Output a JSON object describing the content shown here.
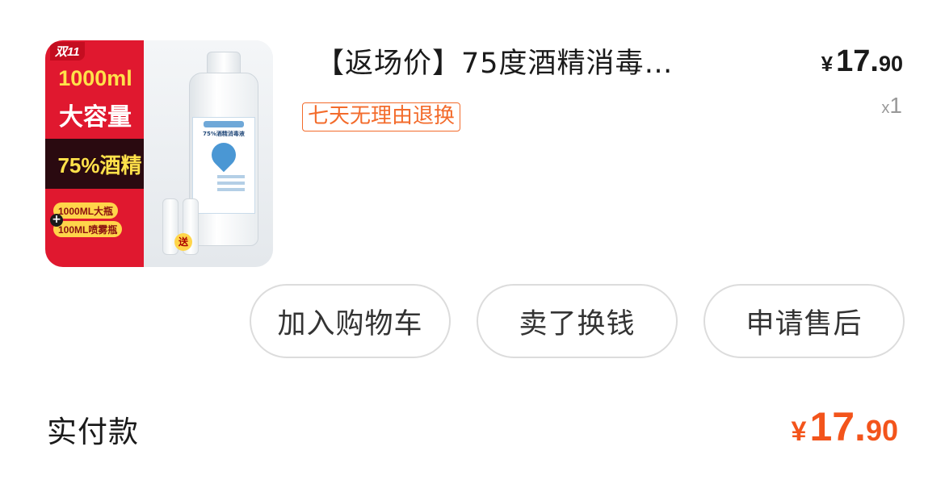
{
  "product": {
    "image": {
      "promo_tag": "双11",
      "volume": "1000ml",
      "capacity": "大容量",
      "alcohol": "75%酒精",
      "pill_1": "1000ML大瓶",
      "pill_2": "100ML喷雾瓶",
      "plus": "+",
      "gift": "送",
      "bottle_label": "75%酒精消毒液"
    },
    "title": "【返场价】75度酒精消毒…",
    "price": {
      "currency": "¥",
      "integer": "17.",
      "decimal": "90"
    },
    "quantity": {
      "prefix": "x",
      "count": "1"
    },
    "service_badge": "七天无理由退换"
  },
  "actions": {
    "add_to_cart": "加入购物车",
    "resell": "卖了换钱",
    "after_sales": "申请售后"
  },
  "summary": {
    "label": "实付款",
    "total": {
      "currency": "¥",
      "integer": "17.",
      "decimal": "90"
    }
  },
  "colors": {
    "accent": "#f3541b",
    "badge": "#f36b2b",
    "promo_red": "#e0182f",
    "promo_yellow": "#ffe14a",
    "muted": "#999999"
  }
}
